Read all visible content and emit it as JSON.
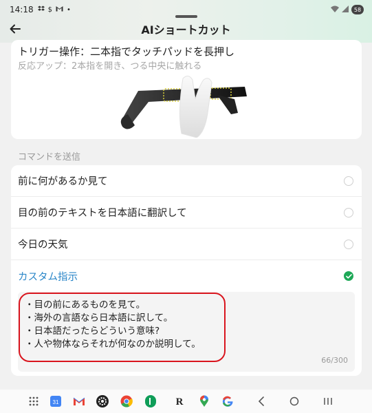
{
  "status_bar": {
    "time": "14:18",
    "left_icons": [
      "dropbox-icon",
      "dollar-icon",
      "gmail-icon",
      "dot-icon"
    ],
    "battery": "58"
  },
  "app_bar": {
    "title": "AIショートカット"
  },
  "trigger": {
    "title": "トリガー操作：二本指でタッチパッドを長押し",
    "subtitle": "反応アップ：2本指を開き、つる中央に触れる"
  },
  "section_label": "コマンドを送信",
  "commands": [
    {
      "label": "前に何があるか見て",
      "selected": false
    },
    {
      "label": "目の前のテキストを日本語に翻訳して",
      "selected": false
    },
    {
      "label": "今日の天気",
      "selected": false
    },
    {
      "label": "カスタム指示",
      "selected": true
    }
  ],
  "custom": {
    "lines": [
      "・目の前にあるものを見て。",
      "・海外の言語なら日本語に訳して。",
      "・日本語だったらどういう意味?",
      "・人や物体ならそれが何なのか説明して。"
    ],
    "counter": "66/300"
  },
  "nav": {
    "calendar_day": "31",
    "dock_icons": [
      "apps-grid-icon",
      "calendar-icon",
      "gmail-icon",
      "settings-icon",
      "chrome-icon",
      "phone-icon",
      "r-app-icon",
      "maps-icon",
      "google-icon"
    ],
    "buttons": [
      "back-nav-icon",
      "home-nav-icon",
      "recents-nav-icon"
    ]
  },
  "colors": {
    "accent": "#2a86c8",
    "check": "#1ea857",
    "highlight": "#d9141d"
  }
}
